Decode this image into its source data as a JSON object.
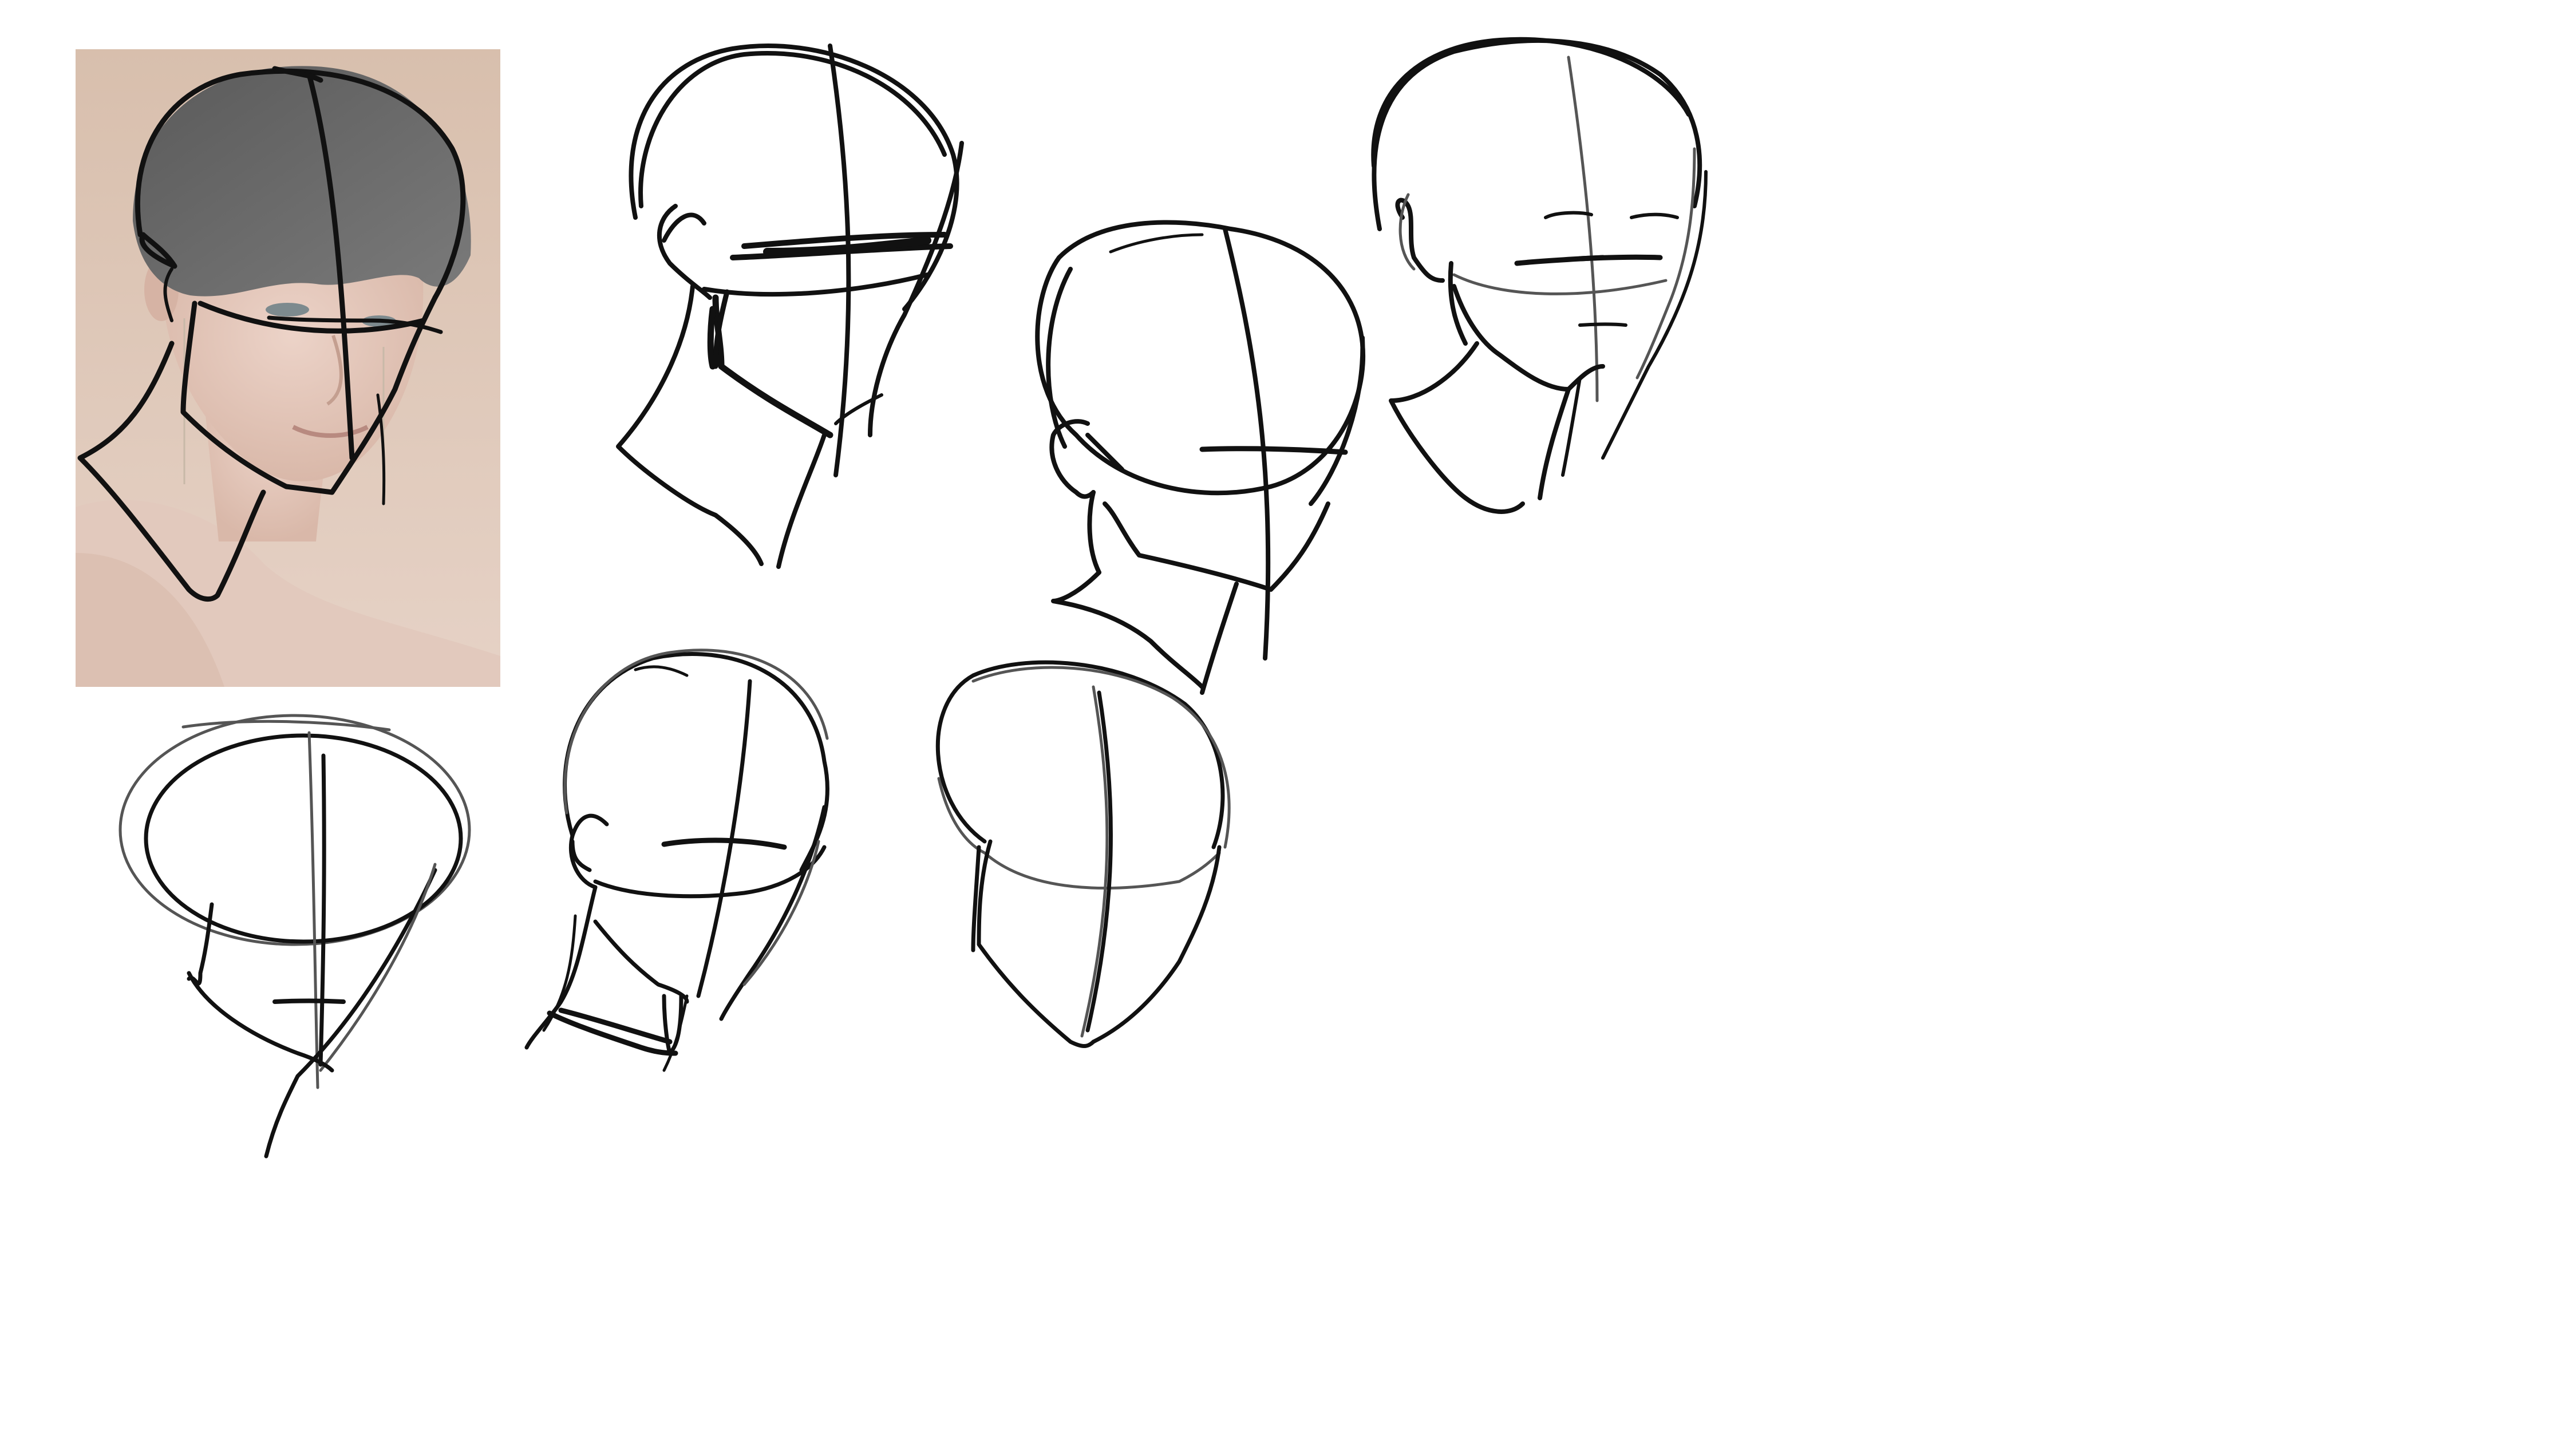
{
  "canvas": {
    "background": "#ffffff"
  },
  "reference_photo": {
    "background_color": "#d9c2b0",
    "hair_color": "#6b6b6b",
    "skin_color": "#e4c8bb"
  },
  "ink": {
    "primary_color": "#111111",
    "guide_color": "#555555"
  },
  "sketches": [
    {
      "name": "photo-overlay-sketch"
    },
    {
      "name": "head-sketch-1"
    },
    {
      "name": "head-sketch-2"
    },
    {
      "name": "head-sketch-3"
    },
    {
      "name": "head-sketch-4"
    },
    {
      "name": "head-sketch-5"
    },
    {
      "name": "head-sketch-6"
    }
  ]
}
